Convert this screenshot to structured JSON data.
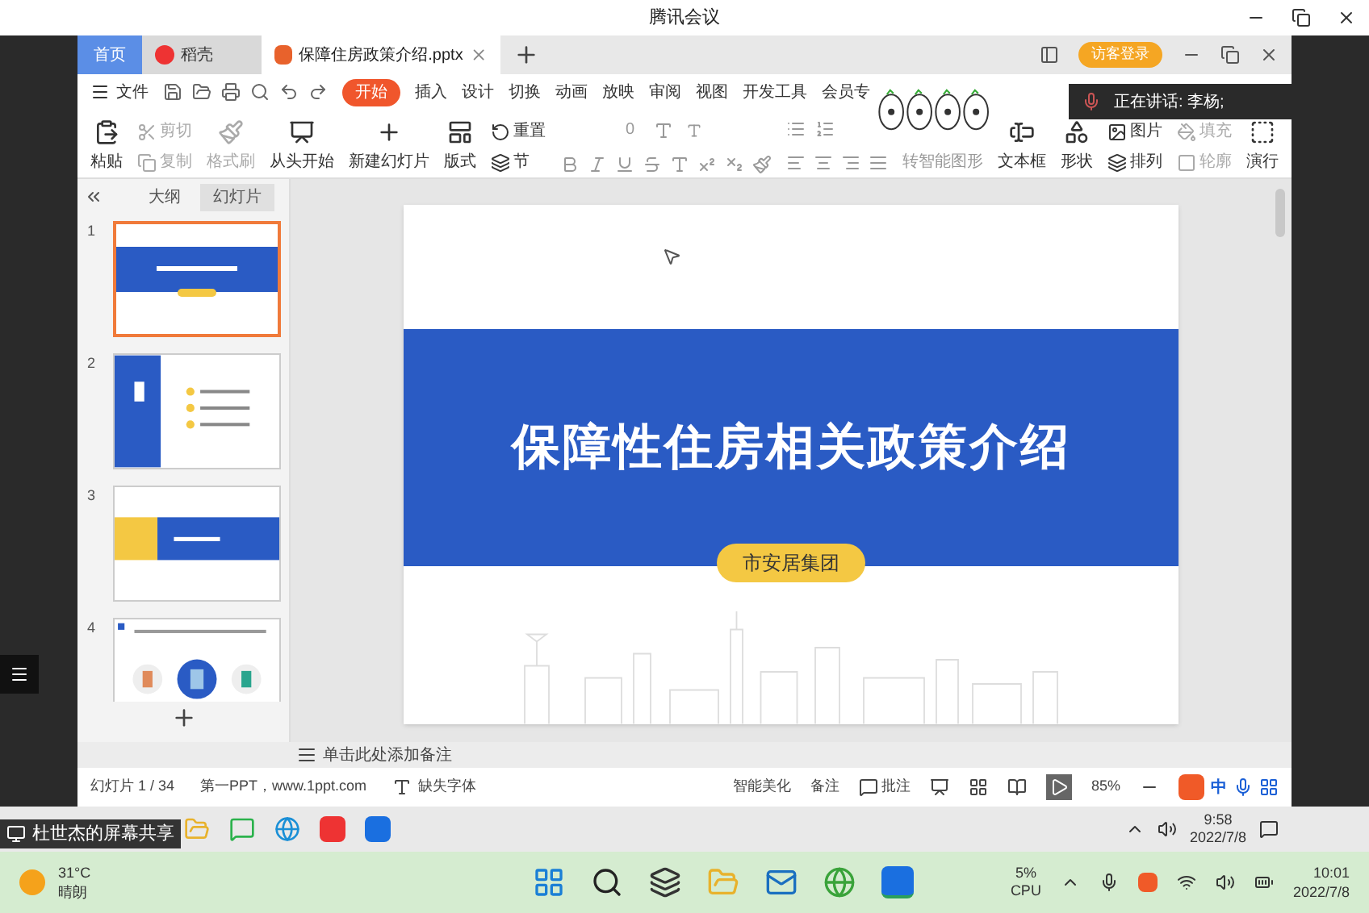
{
  "window": {
    "title": "腾讯会议"
  },
  "wps_tabs": [
    {
      "label": "首页",
      "kind": "home",
      "selected": false
    },
    {
      "label": "稻壳",
      "kind": "docer",
      "selected": false
    },
    {
      "label": "保障住房政策介绍.pptx",
      "kind": "doc",
      "selected": true
    }
  ],
  "login_button": "访客登录",
  "file_menu": "文件",
  "ribbon_tabs": [
    {
      "label": "开始",
      "selected": true
    },
    {
      "label": "插入",
      "selected": false
    },
    {
      "label": "设计",
      "selected": false
    },
    {
      "label": "切换",
      "selected": false
    },
    {
      "label": "动画",
      "selected": false
    },
    {
      "label": "放映",
      "selected": false
    },
    {
      "label": "审阅",
      "selected": false
    },
    {
      "label": "视图",
      "selected": false
    },
    {
      "label": "开发工具",
      "selected": false
    },
    {
      "label": "会员专",
      "selected": false
    }
  ],
  "toolbar": [
    {
      "kind": "big",
      "label": "粘贴",
      "disabled": false
    },
    {
      "kind": "pair",
      "top": {
        "label": "剪切",
        "disabled": true
      },
      "bottom": {
        "label": "复制",
        "disabled": true
      }
    },
    {
      "kind": "big",
      "label": "格式刷",
      "disabled": true
    },
    {
      "kind": "big",
      "label": "从头开始",
      "disabled": false
    },
    {
      "kind": "big",
      "label": "新建幻灯片",
      "disabled": false
    },
    {
      "kind": "big",
      "label": "版式",
      "disabled": false
    },
    {
      "kind": "pair",
      "top": {
        "label": "重置",
        "disabled": false
      },
      "bottom": {
        "label": "节",
        "disabled": false
      }
    },
    {
      "kind": "font",
      "size": "0"
    },
    {
      "kind": "para",
      "label": "转智能图形"
    },
    {
      "kind": "big",
      "label": "文本框",
      "disabled": false
    },
    {
      "kind": "big",
      "label": "形状",
      "disabled": false
    },
    {
      "kind": "pair",
      "top": {
        "label": "图片",
        "disabled": false
      },
      "bottom": {
        "label": "排列",
        "disabled": false
      }
    },
    {
      "kind": "pair",
      "top": {
        "label": "填充",
        "disabled": true
      },
      "bottom": {
        "label": "轮廓",
        "disabled": true
      }
    },
    {
      "kind": "big",
      "label": "演行",
      "disabled": false
    }
  ],
  "speaker": {
    "text": "正在讲话: 李杨;"
  },
  "pane_tabs": [
    {
      "label": "大纲",
      "selected": false
    },
    {
      "label": "幻灯片",
      "selected": true
    }
  ],
  "slides": [
    {
      "number": "1",
      "kind": "title",
      "selected": true
    },
    {
      "number": "2",
      "kind": "toc",
      "selected": false
    },
    {
      "number": "3",
      "kind": "section",
      "selected": false
    },
    {
      "number": "4",
      "kind": "content",
      "selected": false
    }
  ],
  "slide": {
    "title": "保障性住房相关政策介绍",
    "subtitle": "市安居集团"
  },
  "notes_placeholder": "单击此处添加备注",
  "status_bar": {
    "slide_count": "幻灯片 1 / 34",
    "template": "第一PPT，www.1ppt.com",
    "missing_fonts": "缺失字体",
    "beautify": "智能美化",
    "notes": "备注",
    "comments": "批注",
    "zoom": "85%"
  },
  "ime": {
    "mode": "中"
  },
  "share_label": "杜世杰的屏幕共享",
  "remote_clock": {
    "time": "9:58",
    "date": "2022/7/8"
  },
  "weather": {
    "temp": "31°C",
    "condition": "晴朗"
  },
  "cpu": {
    "value": "5%",
    "label": "CPU"
  },
  "clock": {
    "time": "10:01",
    "date": "2022/7/8"
  }
}
